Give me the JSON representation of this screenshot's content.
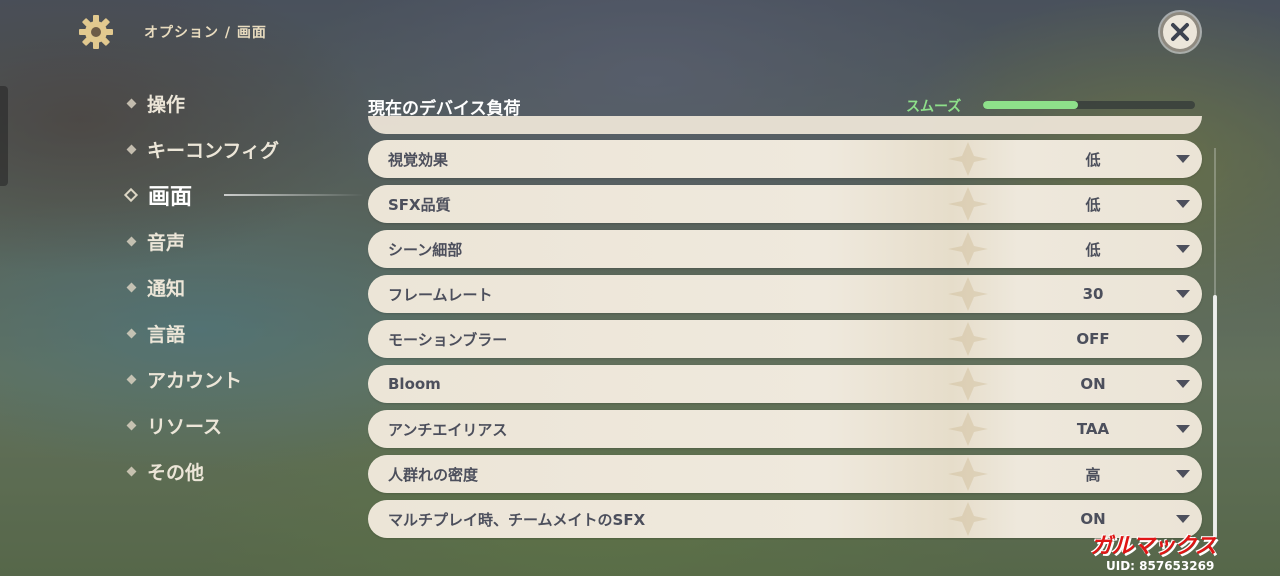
{
  "header": {
    "breadcrumb": "オプション / 画面",
    "gear_icon": "gear-icon",
    "close_icon": "close-icon"
  },
  "sidebar": {
    "items": [
      {
        "label": "操作",
        "active": false
      },
      {
        "label": "キーコンフィグ",
        "active": false
      },
      {
        "label": "画面",
        "active": true
      },
      {
        "label": "音声",
        "active": false
      },
      {
        "label": "通知",
        "active": false
      },
      {
        "label": "言語",
        "active": false
      },
      {
        "label": "アカウント",
        "active": false
      },
      {
        "label": "リソース",
        "active": false
      },
      {
        "label": "その他",
        "active": false
      }
    ]
  },
  "device_load": {
    "title": "現在のデバイス負荷",
    "status": "スムーズ",
    "level": 0.45,
    "color": "#8ee08a"
  },
  "settings": [
    {
      "label": "視覚効果",
      "value": "低"
    },
    {
      "label": "SFX品質",
      "value": "低"
    },
    {
      "label": "シーン細部",
      "value": "低"
    },
    {
      "label": "フレームレート",
      "value": "30"
    },
    {
      "label": "モーションブラー",
      "value": "OFF"
    },
    {
      "label": "Bloom",
      "value": "ON"
    },
    {
      "label": "アンチエイリアス",
      "value": "TAA"
    },
    {
      "label": "人群れの密度",
      "value": "高"
    },
    {
      "label": "マルチプレイ時、チームメイトのSFX",
      "value": "ON"
    }
  ],
  "watermark": {
    "text": "ガルマックス",
    "color": "#e01616"
  },
  "uid": "UID: 857653269"
}
